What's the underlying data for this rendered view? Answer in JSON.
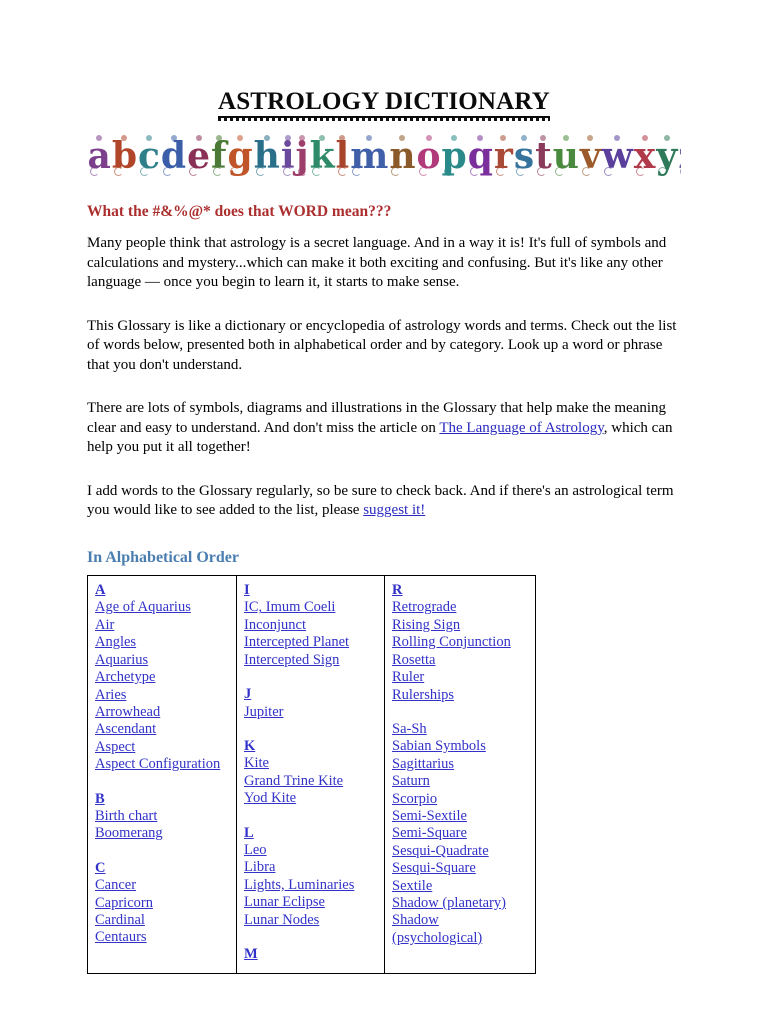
{
  "document": {
    "title": "ASTROLOGY DICTIONARY",
    "alphabet_band": "abcdefghijklmnopqrstuvwxyz"
  },
  "intro": {
    "heading": "What the #&%@* does that WORD mean???",
    "paragraph_1": "Many people think that astrology is a secret language. And in a way it is! It's full of symbols and calculations and mystery...which can make it both exciting and confusing. But it's like any other language — once you begin to learn it, it starts to make sense.",
    "paragraph_2": "This Glossary is like a dictionary or encyclopedia of astrology words and terms. Check out the list of words below, presented both in alphabetical order and by category. Look up a word or phrase that you don't understand.",
    "paragraph_3_before_link": "There are lots of symbols, diagrams and illustrations in the Glossary that help make the meaning clear and easy to understand. And don't miss the article on ",
    "paragraph_3_link": "The Language of Astrology",
    "paragraph_3_after_link": ", which can help you put it all together!",
    "paragraph_4_before_link": "I add words to the Glossary regularly, so be sure to check back. And if there's an astrological term you would like to see added to the list, please ",
    "paragraph_4_link": "suggest it!",
    "paragraph_4_after_link": ""
  },
  "index": {
    "heading": "In Alphabetical Order",
    "columns": [
      {
        "name": "column-a-to-c",
        "entries": [
          {
            "label": "A",
            "letter": true
          },
          {
            "label": "Age of Aquarius",
            "letter": false
          },
          {
            "label": "Air",
            "letter": false
          },
          {
            "label": "Angles",
            "letter": false
          },
          {
            "label": "Aquarius",
            "letter": false
          },
          {
            "label": "Archetype",
            "letter": false
          },
          {
            "label": "Aries",
            "letter": false
          },
          {
            "label": "Arrowhead",
            "letter": false
          },
          {
            "label": "Ascendant",
            "letter": false
          },
          {
            "label": "Aspect",
            "letter": false
          },
          {
            "label": "Aspect Configuration",
            "letter": false
          },
          {
            "label": "",
            "letter": false,
            "spacer": true
          },
          {
            "label": "B",
            "letter": true
          },
          {
            "label": "Birth chart",
            "letter": false
          },
          {
            "label": "Boomerang",
            "letter": false
          },
          {
            "label": "",
            "letter": false,
            "spacer": true
          },
          {
            "label": "C",
            "letter": true
          },
          {
            "label": "Cancer",
            "letter": false
          },
          {
            "label": "Capricorn",
            "letter": false
          },
          {
            "label": "Cardinal",
            "letter": false
          },
          {
            "label": "Centaurs",
            "letter": false
          }
        ]
      },
      {
        "name": "column-i-to-m",
        "entries": [
          {
            "label": "I",
            "letter": true
          },
          {
            "label": "IC, Imum Coeli",
            "letter": false
          },
          {
            "label": "Inconjunct",
            "letter": false
          },
          {
            "label": "Intercepted Planet",
            "letter": false
          },
          {
            "label": "Intercepted Sign",
            "letter": false
          },
          {
            "label": "",
            "letter": false,
            "spacer": true
          },
          {
            "label": "J",
            "letter": true
          },
          {
            "label": "Jupiter",
            "letter": false
          },
          {
            "label": "",
            "letter": false,
            "spacer": true
          },
          {
            "label": "K",
            "letter": true
          },
          {
            "label": "Kite",
            "letter": false
          },
          {
            "label": "Grand Trine Kite",
            "letter": false
          },
          {
            "label": "Yod Kite",
            "letter": false
          },
          {
            "label": "",
            "letter": false,
            "spacer": true
          },
          {
            "label": "L",
            "letter": true
          },
          {
            "label": "Leo",
            "letter": false
          },
          {
            "label": "Libra",
            "letter": false
          },
          {
            "label": "Lights, Luminaries",
            "letter": false
          },
          {
            "label": "Lunar Eclipse",
            "letter": false
          },
          {
            "label": "Lunar Nodes",
            "letter": false
          },
          {
            "label": "",
            "letter": false,
            "spacer": true
          },
          {
            "label": "M",
            "letter": true
          }
        ]
      },
      {
        "name": "column-r-to-s",
        "entries": [
          {
            "label": "R",
            "letter": true
          },
          {
            "label": "Retrograde",
            "letter": false
          },
          {
            "label": "Rising Sign",
            "letter": false
          },
          {
            "label": "Rolling Conjunction",
            "letter": false
          },
          {
            "label": "Rosetta",
            "letter": false
          },
          {
            "label": "Ruler",
            "letter": false
          },
          {
            "label": "Rulerships",
            "letter": false
          },
          {
            "label": "",
            "letter": false,
            "spacer": true
          },
          {
            "label": "Sa-Sh",
            "letter": false
          },
          {
            "label": "Sabian Symbols",
            "letter": false
          },
          {
            "label": "Sagittarius",
            "letter": false
          },
          {
            "label": "Saturn",
            "letter": false
          },
          {
            "label": "Scorpio",
            "letter": false
          },
          {
            "label": "Semi-Sextile",
            "letter": false
          },
          {
            "label": "Semi-Square",
            "letter": false
          },
          {
            "label": "Sesqui-Quadrate",
            "letter": false
          },
          {
            "label": "Sesqui-Square",
            "letter": false
          },
          {
            "label": "Sextile",
            "letter": false
          },
          {
            "label": "Shadow (planetary)",
            "letter": false
          },
          {
            "label": "Shadow (psychological)",
            "letter": false
          }
        ]
      }
    ]
  },
  "colors": {
    "link": "#3232c8",
    "inline_link": "#2a2ac0",
    "red_heading": "#ac2f2f",
    "blue_heading": "#4a7eb0",
    "text": "#000000",
    "page_background": "#ffffff",
    "table_border": "#000000"
  },
  "alphabet_glyph_colors": [
    "#7b3f8c",
    "#b0452a",
    "#2f7f8a",
    "#3b5ea8",
    "#8a2f55",
    "#4a7a35",
    "#c0552a",
    "#2a6f8a",
    "#6a4a9c",
    "#9c3f6a",
    "#2f8a6a",
    "#a8442a",
    "#3f5fa8",
    "#8a5a2a",
    "#b03a7a",
    "#2a8a8a",
    "#7a2f9c",
    "#a84a35",
    "#35729c",
    "#8a3a5a",
    "#4a8a3f",
    "#9c5a2a",
    "#5a3f9c",
    "#b03a4a",
    "#2f7a5a",
    "#6a5a9c"
  ]
}
